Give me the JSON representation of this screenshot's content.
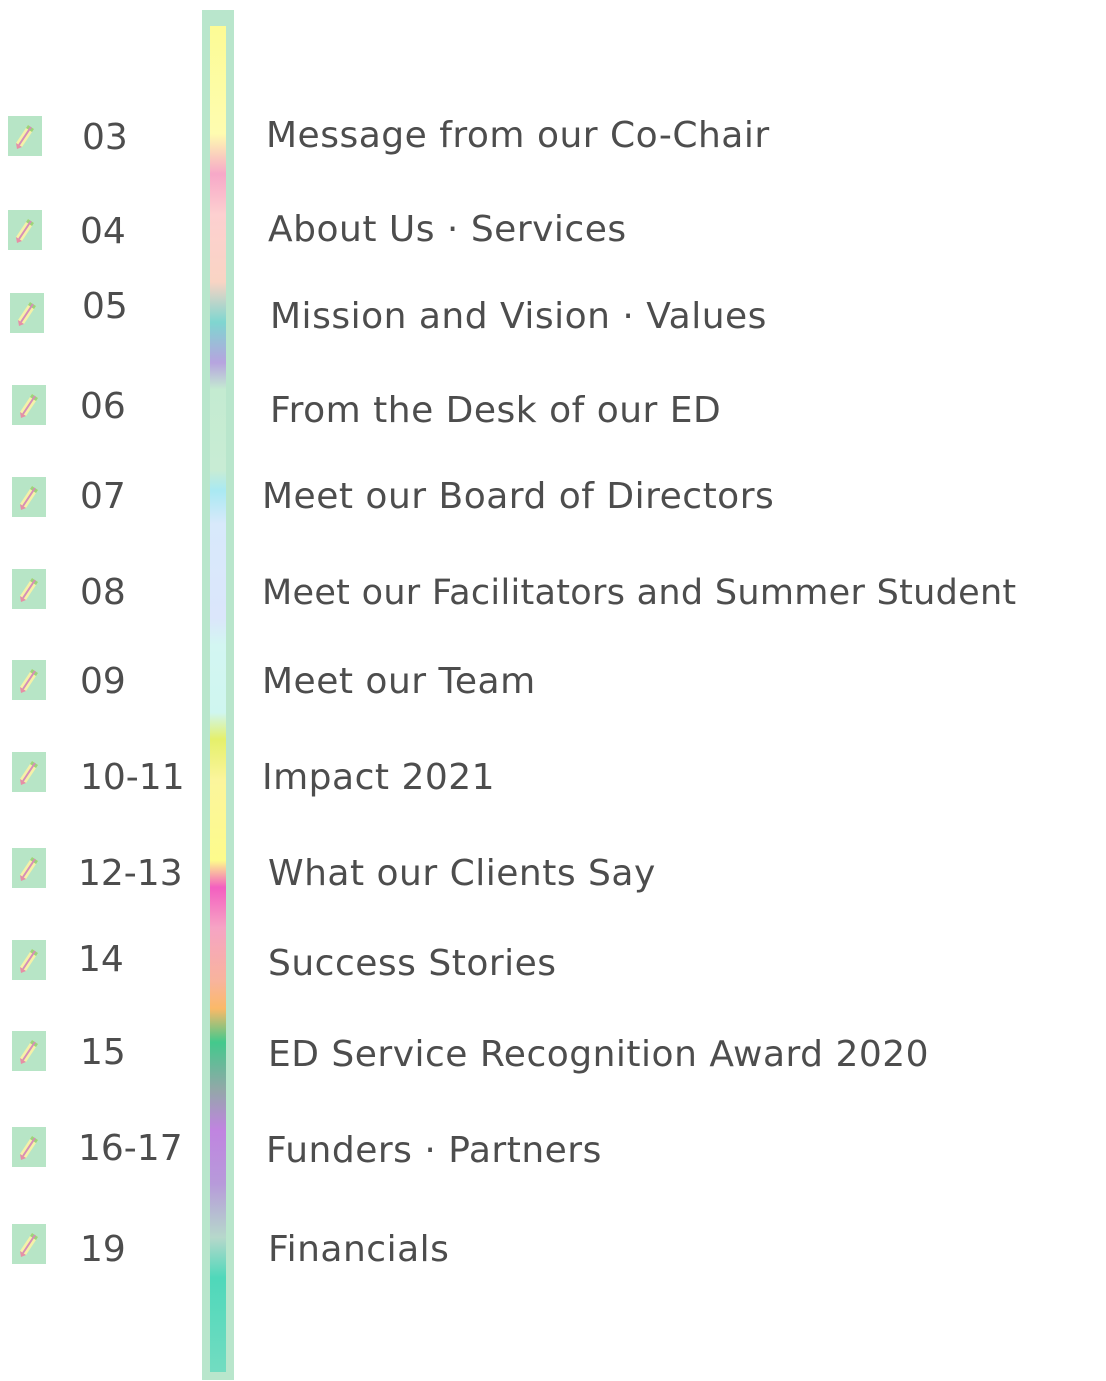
{
  "toc": {
    "entries": [
      {
        "page": "03",
        "title": "Message from our Co-Chair"
      },
      {
        "page": "04",
        "title": "About Us · Services"
      },
      {
        "page": "05",
        "title": "Mission and Vision · Values"
      },
      {
        "page": "06",
        "title": "From the Desk of our ED"
      },
      {
        "page": "07",
        "title": "Meet our Board of Directors"
      },
      {
        "page": "08",
        "title": "Meet our Facilitators and Summer Student"
      },
      {
        "page": "09",
        "title": "Meet our Team"
      },
      {
        "page": "10-11",
        "title": "Impact 2021"
      },
      {
        "page": "12-13",
        "title": "What our Clients Say"
      },
      {
        "page": "14",
        "title": "Success Stories"
      },
      {
        "page": "15",
        "title": "ED Service Recognition Award 2020"
      },
      {
        "page": "16-17",
        "title": "Funders · Partners"
      },
      {
        "page": "19",
        "title": "Financials"
      }
    ]
  },
  "colors": {
    "text": "#4d4d4d",
    "divider_frame": "#b9e6cc",
    "bullet_background": "#b7e5c6"
  },
  "icons": {
    "bullet": "pencil-icon"
  }
}
